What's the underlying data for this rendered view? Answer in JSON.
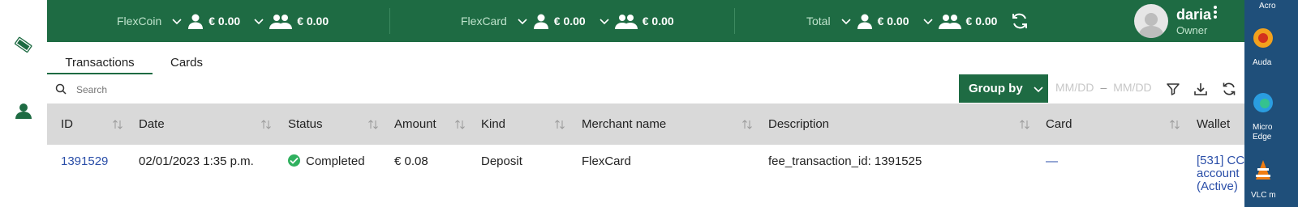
{
  "nav": {
    "icons": [
      "tag-icon",
      "person-icon"
    ]
  },
  "balances": {
    "groups": [
      {
        "label": "FlexCoin",
        "personal": "€ 0.00",
        "team": "€ 0.00"
      },
      {
        "label": "FlexCard",
        "personal": "€ 0.00",
        "team": "€ 0.00"
      },
      {
        "label": "Total",
        "personal": "€ 0.00",
        "team": "€ 0.00"
      }
    ]
  },
  "user": {
    "name": "daria",
    "role": "Owner"
  },
  "tabs": [
    {
      "label": "Transactions",
      "active": true
    },
    {
      "label": "Cards",
      "active": false
    }
  ],
  "toolbar": {
    "search_placeholder": "Search",
    "group_by_label": "Group by",
    "date_from_placeholder": "MM/DD",
    "date_to_placeholder": "MM/DD",
    "date_separator": "–"
  },
  "table": {
    "columns": [
      "ID",
      "Date",
      "Status",
      "Amount",
      "Kind",
      "Merchant name",
      "Description",
      "Card",
      "Wallet"
    ],
    "rows": [
      {
        "id": "1391529",
        "date": "02/01/2023 1:35 p.m.",
        "status": "Completed",
        "amount": "€ 0.08",
        "kind": "Deposit",
        "merchant": "FlexCard",
        "description": "fee_transaction_id: 1391525",
        "card": "—",
        "wallet": [
          "[531] CC",
          "account",
          "(Active)"
        ]
      }
    ]
  },
  "desktop": {
    "items": [
      "Acro",
      "Auda",
      "Micro",
      "Edge",
      "VLC m"
    ]
  },
  "colors": {
    "brand_green": "#1e6b43",
    "link_blue": "#2a4ea8",
    "status_green": "#2fb05e"
  }
}
